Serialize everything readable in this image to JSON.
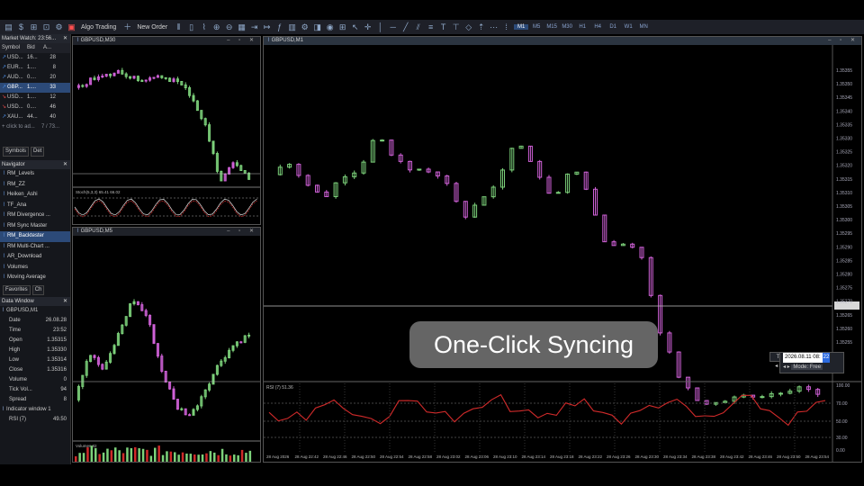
{
  "toolbar": {
    "algo_trading": "Algo Trading",
    "new_order": "New Order",
    "timeframes": [
      "M1",
      "M5",
      "M15",
      "M30",
      "H1",
      "H4",
      "D1",
      "W1",
      "MN"
    ],
    "active_timeframe": "M1"
  },
  "market_watch": {
    "title": "Market Watch: 23:56...",
    "headers": [
      "Symbol",
      "Bid",
      "A..."
    ],
    "rows": [
      {
        "symbol": "USD...",
        "bid": "16...",
        "ask": "28",
        "arrow": "up"
      },
      {
        "symbol": "EUR...",
        "bid": "1....",
        "ask": "8",
        "arrow": "up"
      },
      {
        "symbol": "AUD...",
        "bid": "0....",
        "ask": "20",
        "arrow": "up"
      },
      {
        "symbol": "GBP...",
        "bid": "1....",
        "ask": "33",
        "arrow": "up",
        "selected": true
      },
      {
        "symbol": "USD...",
        "bid": "1....",
        "ask": "12",
        "arrow": "down"
      },
      {
        "symbol": "USD...",
        "bid": "0....",
        "ask": "46",
        "arrow": "down"
      },
      {
        "symbol": "XAU...",
        "bid": "44...",
        "ask": "40",
        "arrow": "up"
      }
    ],
    "add_row": "click to ad...",
    "count": "7 / 73...",
    "tabs": [
      "Symbols",
      "Det"
    ]
  },
  "navigator": {
    "title": "Navigator",
    "items": [
      "RM_Levels",
      "RM_ZZ",
      "Heiken_Ashi",
      "TF_Ana",
      "RM Divergence ...",
      "RM Sync Master",
      "RM_Backtester",
      "RM Multi-Chart ...",
      "AR_Download",
      "Volumes",
      "Moving Average"
    ],
    "selected_index": 6,
    "tabs": [
      "Favorites",
      "Ch"
    ]
  },
  "data_window": {
    "title": "Data Window",
    "symbol": "GBPUSD,M1",
    "rows": [
      {
        "label": "Date",
        "value": "26.08.28"
      },
      {
        "label": "Time",
        "value": "23:52"
      },
      {
        "label": "Open",
        "value": "1.35315"
      },
      {
        "label": "High",
        "value": "1.35330"
      },
      {
        "label": "Low",
        "value": "1.35314"
      },
      {
        "label": "Close",
        "value": "1.35316"
      },
      {
        "label": "Volume",
        "value": "0"
      },
      {
        "label": "Tick Vol...",
        "value": "94"
      },
      {
        "label": "Spread",
        "value": "8"
      }
    ],
    "indicator_window": "Indicator window 1",
    "rsi_label": "RSI (7)",
    "rsi_value": "49.50"
  },
  "charts": {
    "m30_title": "GBPUSD,M30",
    "m30_sub_label": "Stoch(5,3,3) 65.41 66.02",
    "m5_title": "GBPUSD,M5",
    "m5_sub_label": "Volumes 82",
    "m1_title": "GBPUSD,M1",
    "m1_rsi_label": "RSI (7) 51.36",
    "price_labels": [
      "1.35355",
      "1.35350",
      "1.35345",
      "1.35340",
      "1.35335",
      "1.35330",
      "1.35325",
      "1.35320",
      "1.35315",
      "1.35310",
      "1.35305",
      "1.35300",
      "1.35295",
      "1.35290",
      "1.35285",
      "1.35280",
      "1.35275",
      "1.35270",
      "1.35265",
      "1.35260",
      "1.35255"
    ],
    "rsi_scale": [
      "100.00",
      "70.00",
      "50.00",
      "30.00",
      "0.00"
    ],
    "time_labels": [
      "28 Aug 2026",
      "28 Aug 22:42",
      "28 Aug 22:46",
      "28 Aug 22:50",
      "28 Aug 22:54",
      "28 Aug 22:58",
      "28 Aug 23:02",
      "28 Aug 23:06",
      "28 Aug 23:10",
      "28 Aug 23:14",
      "28 Aug 23:18",
      "28 Aug 23:22",
      "28 Aug 23:26",
      "28 Aug 23:30",
      "28 Aug 23:34",
      "28 Aug 23:38",
      "28 Aug 23:42",
      "28 Aug 23:46",
      "28 Aug 23:50",
      "28 Aug 23:54"
    ]
  },
  "sync_panel": {
    "date": "2026.08.11",
    "time": "08:",
    "time_sel": "22",
    "mode": "Mode: Free"
  },
  "caption": "One-Click Syncing",
  "colors": {
    "bull": "#7cd17a",
    "bear": "#d061d8",
    "rsi": "#d02a2a",
    "accent": "#2c4a78"
  }
}
